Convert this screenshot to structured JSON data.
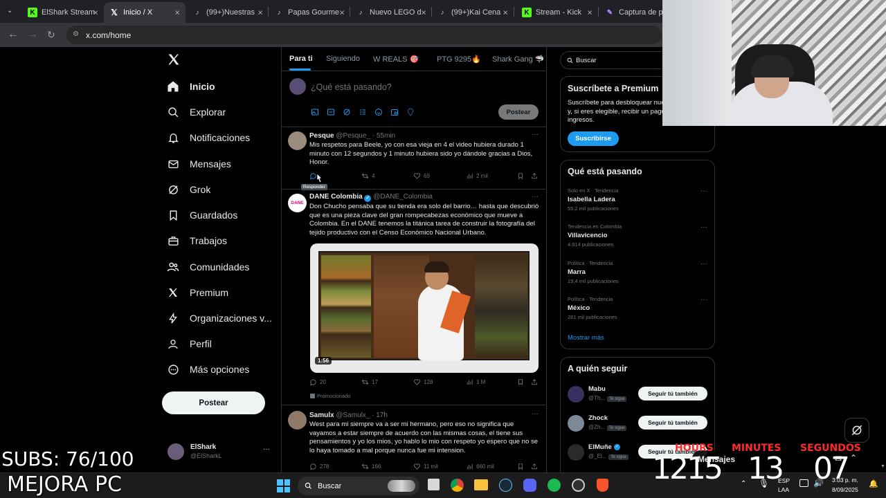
{
  "browser": {
    "tabs": [
      {
        "title": "ElShark Stream",
        "icon": "kick-icon",
        "color": "#53fc18"
      },
      {
        "title": "Inicio / X",
        "icon": "x-icon",
        "color": "#ffffff"
      },
      {
        "title": "(99+)Nuestras",
        "icon": "tiktok-icon",
        "color": "#ffffff"
      },
      {
        "title": "Papas Gourme",
        "icon": "tiktok-icon",
        "color": "#ffffff"
      },
      {
        "title": "Nuevo LEGO d",
        "icon": "tiktok-icon",
        "color": "#ffffff"
      },
      {
        "title": "(99+)Kai Cena",
        "icon": "tiktok-icon",
        "color": "#ffffff"
      },
      {
        "title": "Stream - Kick",
        "icon": "kick-icon",
        "color": "#53fc18"
      },
      {
        "title": "Captura de pa",
        "icon": "pen-icon",
        "color": "#b388ff"
      }
    ],
    "url": "x.com/home"
  },
  "sidebar": {
    "items": [
      {
        "label": "Inicio",
        "icon": "home-icon"
      },
      {
        "label": "Explorar",
        "icon": "search-icon"
      },
      {
        "label": "Notificaciones",
        "icon": "bell-icon"
      },
      {
        "label": "Mensajes",
        "icon": "mail-icon"
      },
      {
        "label": "Grok",
        "icon": "grok-icon"
      },
      {
        "label": "Guardados",
        "icon": "bookmark-icon"
      },
      {
        "label": "Trabajos",
        "icon": "briefcase-icon"
      },
      {
        "label": "Comunidades",
        "icon": "people-icon"
      },
      {
        "label": "Premium",
        "icon": "x-icon"
      },
      {
        "label": "Organizaciones v...",
        "icon": "lightning-icon"
      },
      {
        "label": "Perfil",
        "icon": "user-icon"
      },
      {
        "label": "Más opciones",
        "icon": "more-circle-icon"
      }
    ],
    "post_button": "Postear",
    "account": {
      "name": "ElShark",
      "handle": "@ElSharkL",
      "more": "···"
    }
  },
  "feed": {
    "tabs": [
      "Para ti",
      "Siguiendo",
      "W REALS 🎯",
      "PTG 9295🔥",
      "Shark Gang 🦈"
    ],
    "composer": {
      "placeholder": "¿Qué está pasando?",
      "post_button": "Postear"
    },
    "tweets": [
      {
        "name": "Pesque",
        "handle": "@Pesque_ · 55min",
        "text": "Mis respetos para Beele, yo con esa vieja en 4 el video hubiera durado 1 minuto con 12 segundos y 1 minuto hubiera sido yo dándole gracias a Dios, Honor.",
        "replies": "",
        "retweets": "4",
        "likes": "69",
        "views": "2 mil",
        "tooltip": "Responder"
      },
      {
        "name": "DANE Colombia",
        "handle": "@DANE_Colombia",
        "text": "Don Chucho pensaba que su tienda era solo del barrio… hasta que descubrió que es una pieza clave del gran rompecabezas económico que mueve a Colombia.  En el DANE tenemos la titánica tarea de construir la fotografía del tejido productivo con el Censo Económico Nacional Urbano.",
        "video_duration": "1:56",
        "replies": "20",
        "retweets": "17",
        "likes": "128",
        "views": "1 M",
        "promoted": "Promocionado",
        "avatar_text": "DANE"
      },
      {
        "name": "Samulx",
        "handle": "@Samulx_ · 17h",
        "text": "West para mi siempre va a ser mi hermano, pero eso no significa que vayamos a estar siempre de acuerdo con las mismas cosas, el tiene sus pensamientos y yo los mios, yo hablo lo mio con respeto yo espero que no se lo haya tomado a mal porque nunca fue mi intension.",
        "replies": "278",
        "retweets": "166",
        "likes": "11 mil",
        "views": "660 mil"
      }
    ]
  },
  "right": {
    "search_placeholder": "Buscar",
    "premium": {
      "title": "Suscríbete a Premium",
      "text": "Suscríbete para desbloquear nuevas funciones y, si eres elegible, recibir un pago de cuota de ingresos.",
      "button": "Suscribirse"
    },
    "trends_title": "Qué está pasando",
    "trends": [
      {
        "meta": "Solo en X · Tendencia",
        "name": "Isabella Ladera",
        "count": "55,2 mil publicaciones"
      },
      {
        "meta": "Tendencia en Colombia",
        "name": "Villavicencio",
        "count": "4.914 publicaciones"
      },
      {
        "meta": "Política · Tendencia",
        "name": "Marra",
        "count": "19,4 mil publicaciones"
      },
      {
        "meta": "Política · Tendencia",
        "name": "México",
        "count": "281 mil publicaciones"
      }
    ],
    "show_more": "Mostrar más",
    "follow_title": "A quién seguir",
    "follow": [
      {
        "name": "Mabu",
        "handle": "@Th...",
        "badge": "Te sigue",
        "button": "Seguir tú también"
      },
      {
        "name": "Zhock",
        "handle": "@Zh...",
        "badge": "Te sigue",
        "button": "Seguir tú también"
      },
      {
        "name": "ElMuñe",
        "handle": "@_El...",
        "badge": "Te sigue",
        "button": "Seguir tú también"
      }
    ],
    "messages_label": "Mensajes"
  },
  "taskbar": {
    "search": "Buscar",
    "lang_top": "ESP",
    "lang_bottom": "LAA",
    "time": "3:03 p. m.",
    "date": "8/09/2025"
  },
  "overlay": {
    "subs": "SUBS: 76/100",
    "goal": "MEJORA PC",
    "timer_labels": {
      "hours": "HOURS",
      "minutes": "MINUTES",
      "seconds": "SEGUNDOS"
    },
    "hours": "1215",
    "minutes": "13",
    "seconds": "07"
  },
  "colors": {
    "accent": "#1d9bf0",
    "timer_label": "#ff2b2b",
    "kick_green": "#53fc18"
  }
}
